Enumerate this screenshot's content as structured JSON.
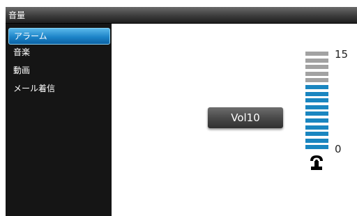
{
  "window": {
    "title": "音量"
  },
  "sidebar": {
    "items": [
      {
        "label": "アラーム",
        "selected": true
      },
      {
        "label": "音楽",
        "selected": false
      },
      {
        "label": "動画",
        "selected": false
      },
      {
        "label": "メール着信",
        "selected": false
      }
    ]
  },
  "volume": {
    "button_label": "Vol10",
    "level": 10,
    "max": 15,
    "min": 0,
    "max_label": "15",
    "min_label": "0",
    "icon": "speaker-icon",
    "colors": {
      "active": "#1a86c0",
      "inactive": "#a2a2a2"
    }
  }
}
